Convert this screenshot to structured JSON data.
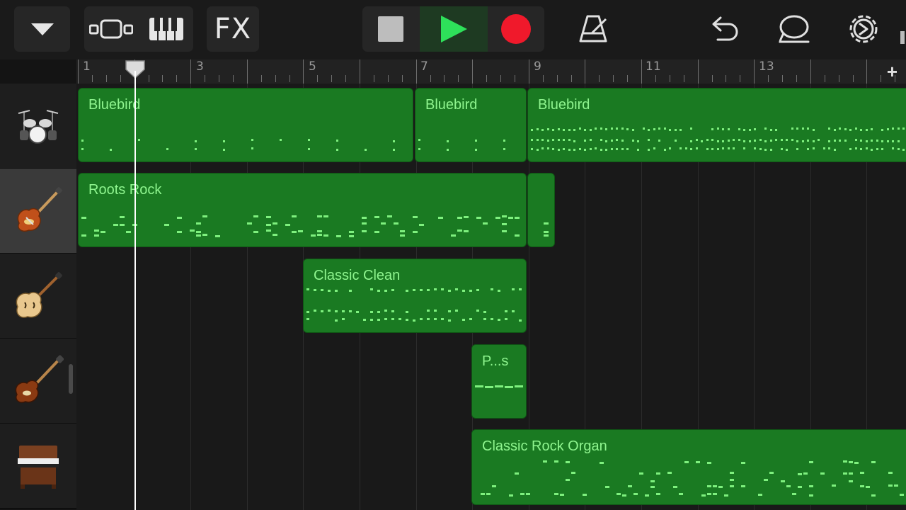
{
  "toolbar": {
    "fx_label": "FX",
    "icons": [
      "chevron-down-icon",
      "tracks-view-icon",
      "keyboard-icon",
      "fx-icon",
      "stop-icon",
      "play-icon",
      "record-icon",
      "metronome-icon",
      "undo-icon",
      "loop-icon",
      "settings-icon"
    ],
    "colors": {
      "play": "#2ee05a",
      "record": "#f0192b",
      "stop": "#bdbdbd"
    }
  },
  "ruler": {
    "numbers": [
      "1",
      "3",
      "5",
      "7",
      "9",
      "11",
      "13"
    ],
    "add_label": "+"
  },
  "tracks": [
    {
      "instrument_icon": "drum-kit-icon",
      "selected": false
    },
    {
      "instrument_icon": "electric-guitar-icon",
      "selected": true
    },
    {
      "instrument_icon": "hollow-body-guitar-icon",
      "selected": false
    },
    {
      "instrument_icon": "bass-guitar-icon",
      "selected": false
    },
    {
      "instrument_icon": "organ-icon",
      "selected": false
    }
  ],
  "regions": [
    {
      "track": 0,
      "name": "Bluebird"
    },
    {
      "track": 0,
      "name": "Bluebird"
    },
    {
      "track": 0,
      "name": "Bluebird"
    },
    {
      "track": 1,
      "name": "Roots Rock"
    },
    {
      "track": 1,
      "name": ""
    },
    {
      "track": 2,
      "name": "Classic Clean"
    },
    {
      "track": 3,
      "name": "P...s"
    },
    {
      "track": 4,
      "name": "Classic Rock Organ"
    }
  ],
  "colors": {
    "region_fill": "#1a7a22",
    "region_text": "#8ff58f",
    "note": "#7ef07e",
    "playhead": "#ffffff"
  }
}
